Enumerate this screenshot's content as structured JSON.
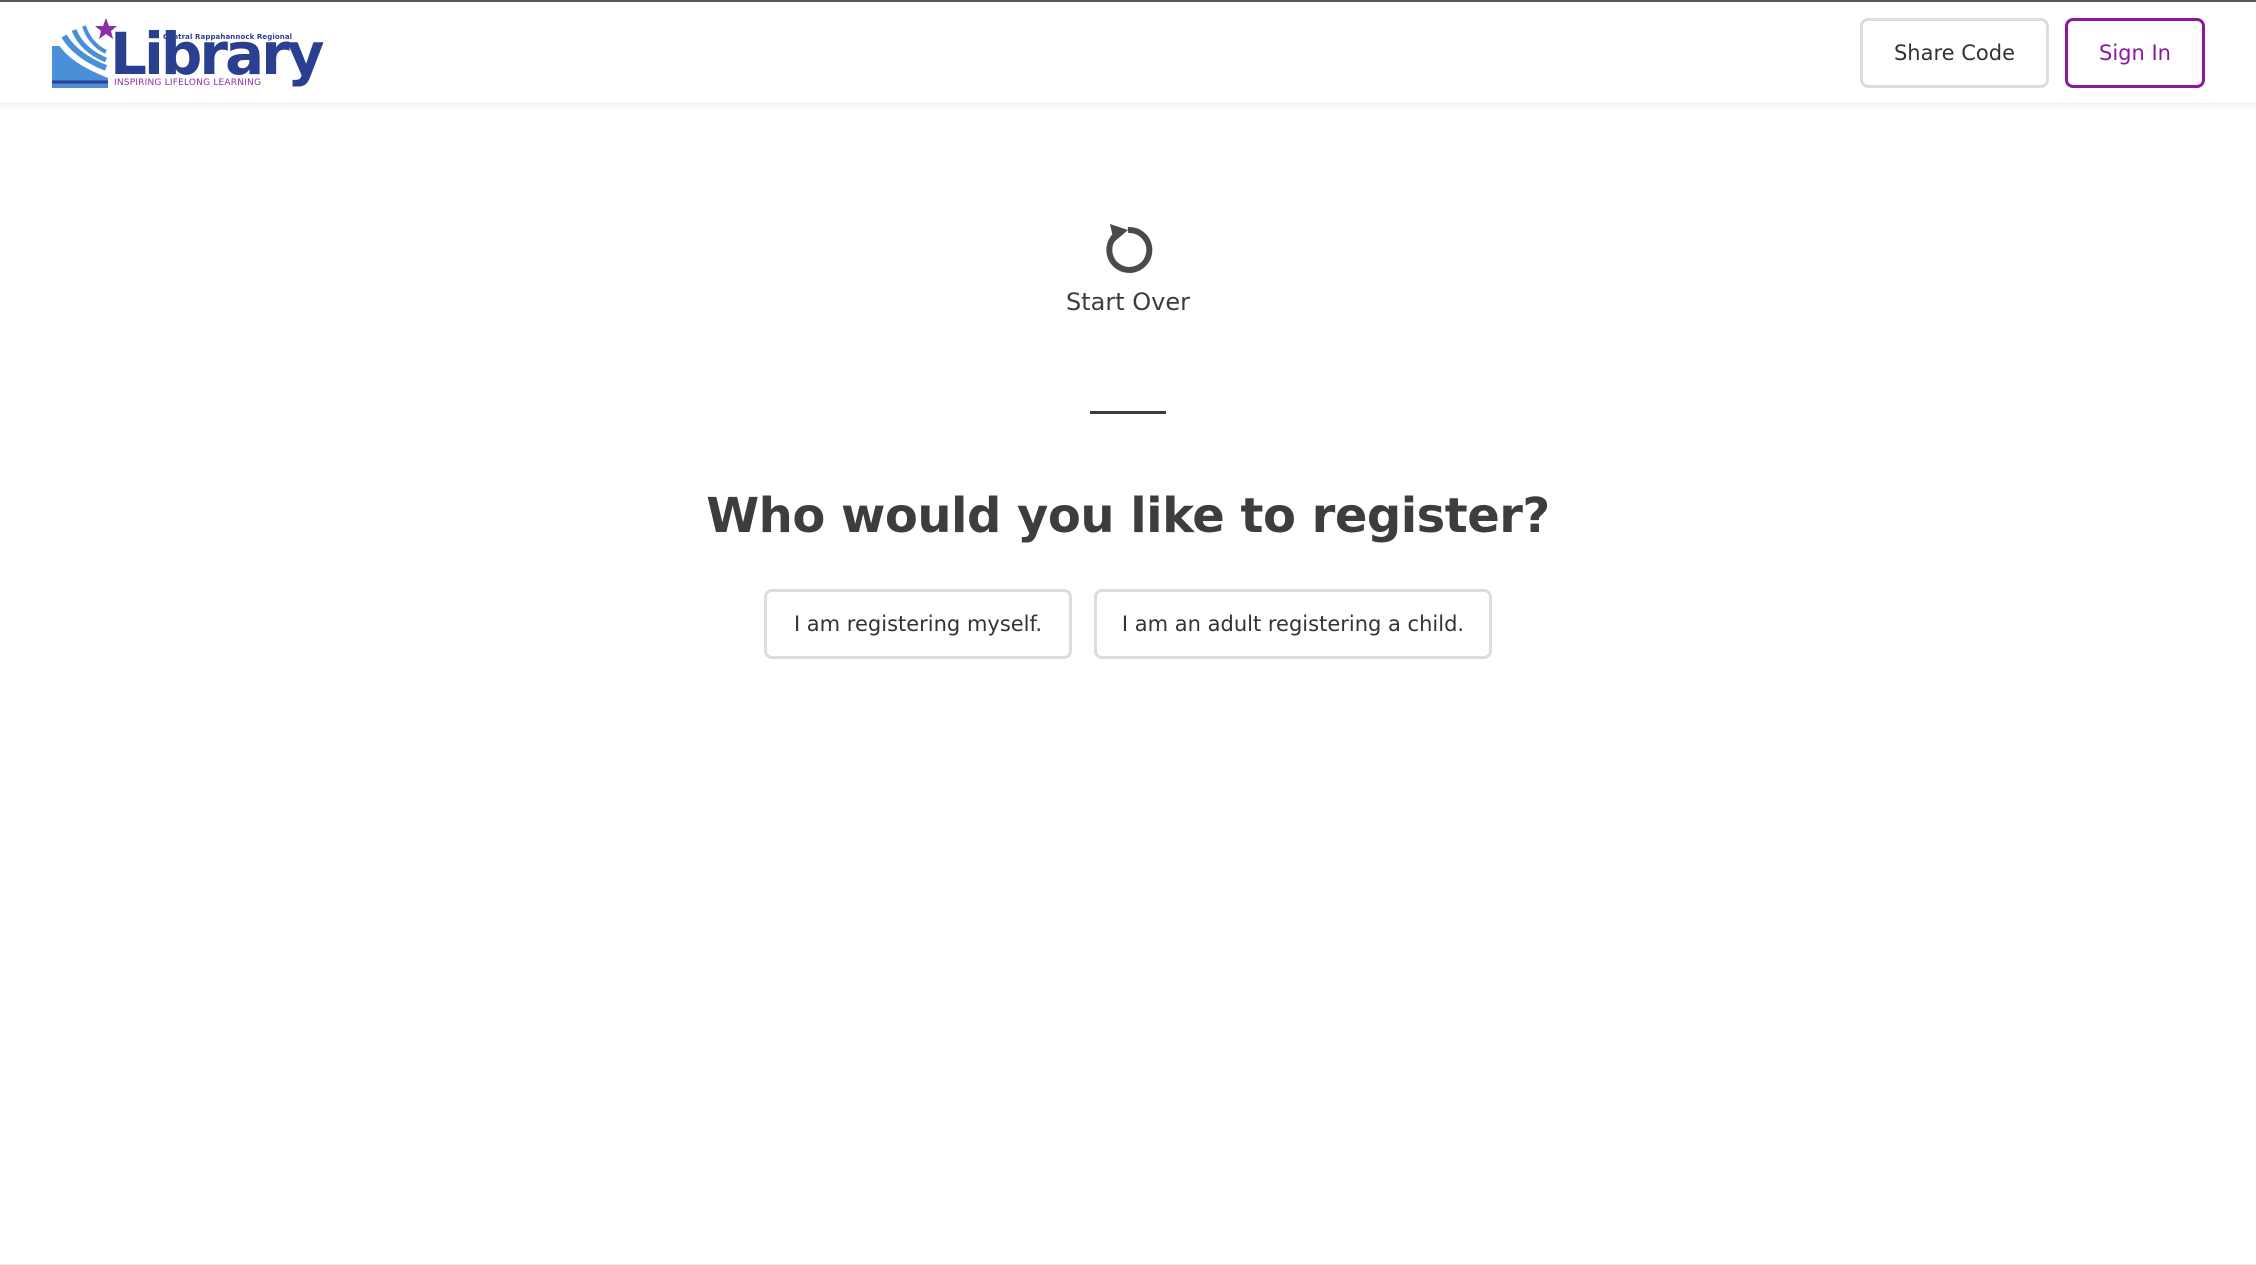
{
  "header": {
    "logo": {
      "top_text": "Central Rappahannock Regional",
      "wordmark": "Library",
      "tagline": "INSPIRING LIFELONG LEARNING"
    },
    "share_code_label": "Share Code",
    "sign_in_label": "Sign In"
  },
  "main": {
    "start_over_label": "Start Over",
    "heading": "Who would you like to register?",
    "options": [
      {
        "label": "I am registering myself."
      },
      {
        "label": "I am an adult registering a child."
      }
    ]
  },
  "colors": {
    "accent": "#8a1a9b",
    "logo_blue": "#2a3f8f",
    "logo_light_blue": "#4a90d9",
    "text": "#3d3d3d",
    "border": "#dcdcdc"
  },
  "icons": {
    "start_over": "refresh-icon",
    "logo_star": "star-icon"
  }
}
